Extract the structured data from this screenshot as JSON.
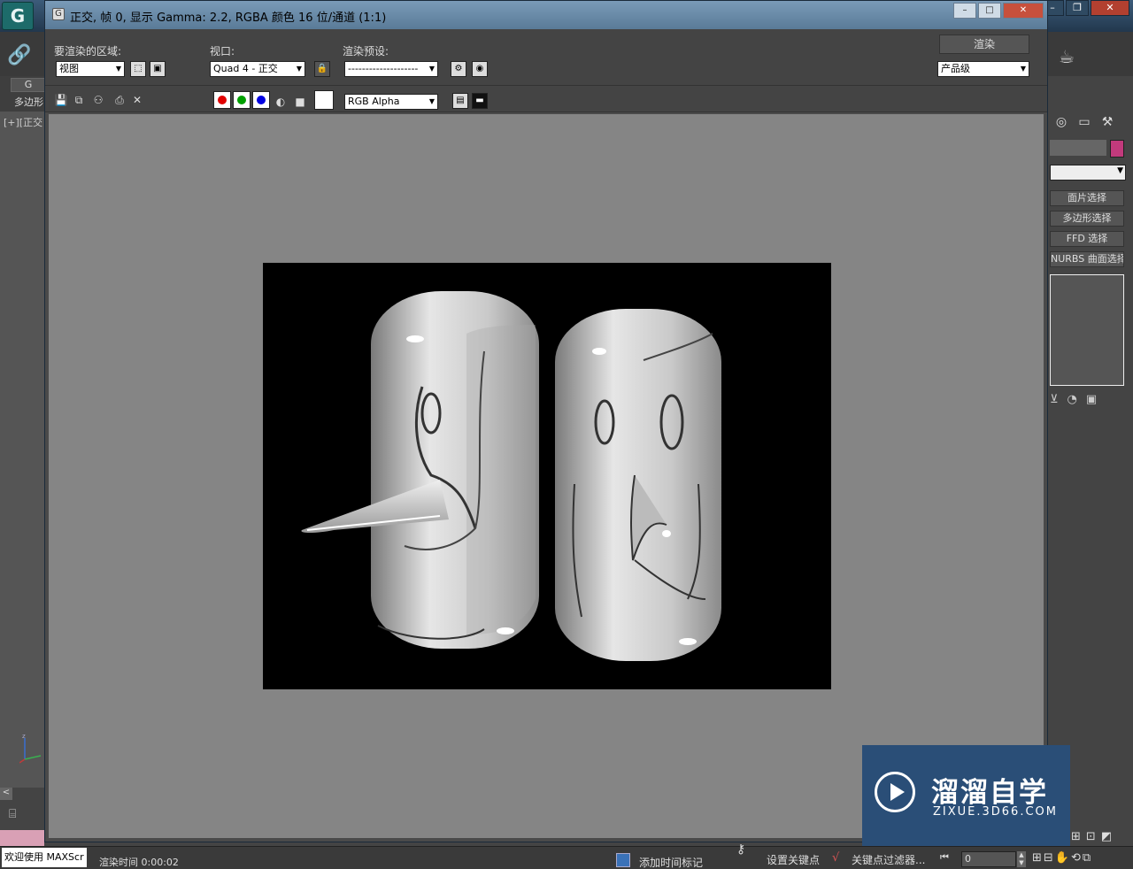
{
  "app": {
    "logo_letter": "G",
    "tab_g": "G",
    "ribbon_label": "多边形",
    "viewport_label": "[+][正交",
    "welcome": "欢迎使用 MAXScr",
    "render_time": "渲染时间 0:00:02",
    "add_time_tag": "添加时间标记",
    "set_key": "设置关键点",
    "key_filters": "关键点过滤器...",
    "frame_value": "0"
  },
  "command_panel": {
    "modifiers": [
      "面片选择",
      "多边形选择",
      "FFD 选择",
      "NURBS 曲面选择"
    ],
    "color_swatch": "#c23a7c"
  },
  "render_window": {
    "title": "正交, 帧 0, 显示 Gamma: 2.2, RGBA 颜色 16 位/通道 (1:1)",
    "area_label": "要渲染的区域:",
    "area_value": "视图",
    "viewport_label": "视口:",
    "viewport_value": "Quad 4 - 正交",
    "preset_label": "渲染预设:",
    "preset_value": "--------------------",
    "render_button": "渲染",
    "quality_value": "产品级",
    "channel_value": "RGB Alpha",
    "channel_colors": {
      "red": "#e00000",
      "green": "#00a000",
      "blue": "#0000e0"
    }
  },
  "watermark": {
    "name": "溜溜自学",
    "url": "ZIXUE.3D66.COM",
    "bg_color": "#2a4e77"
  }
}
